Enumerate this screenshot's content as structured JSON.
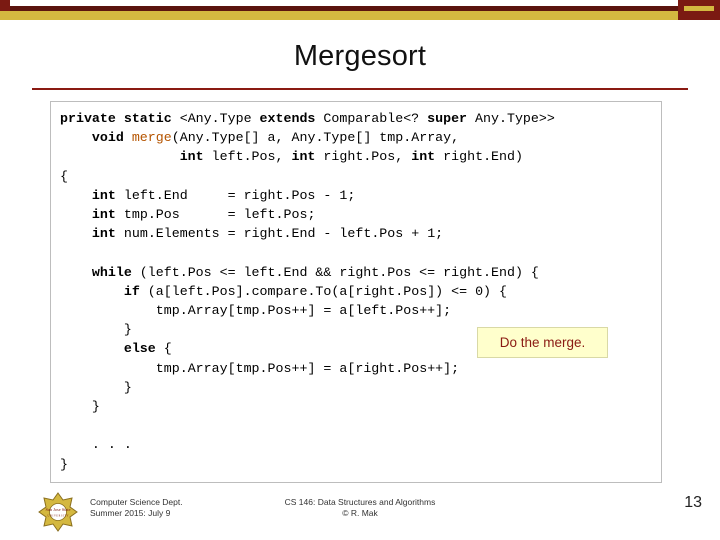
{
  "slide": {
    "title": "Mergesort",
    "page_number": "13",
    "accent_color": "#7b1a12",
    "gold_color": "#d4b840"
  },
  "code": {
    "lines": [
      "private static <Any.Type extends Comparable<? super Any.Type>>",
      "    void merge(Any.Type[] a, Any.Type[] tmp.Array,",
      "               int left.Pos, int right.Pos, int right.End)",
      "{",
      "    int left.End     = right.Pos - 1;",
      "    int tmp.Pos      = left.Pos;",
      "    int num.Elements = right.End - left.Pos + 1;",
      "",
      "    while (left.Pos <= left.End && right.Pos <= right.End) {",
      "        if (a[left.Pos].compare.To(a[right.Pos]) <= 0) {",
      "            tmp.Array[tmp.Pos++] = a[left.Pos++];",
      "        }",
      "        else {",
      "            tmp.Array[tmp.Pos++] = a[right.Pos++];",
      "        }",
      "    }",
      "",
      "    . . .",
      "}"
    ]
  },
  "callout": {
    "label": "Do the merge."
  },
  "footer": {
    "left_line1": "Computer Science Dept.",
    "left_line2": "Summer 2015: July 9",
    "center_line1": "CS 146: Data Structures and Algorithms",
    "center_line2": "© R. Mak",
    "logo_text": "San Jose State",
    "logo_sub": "UNIVERSITY"
  }
}
